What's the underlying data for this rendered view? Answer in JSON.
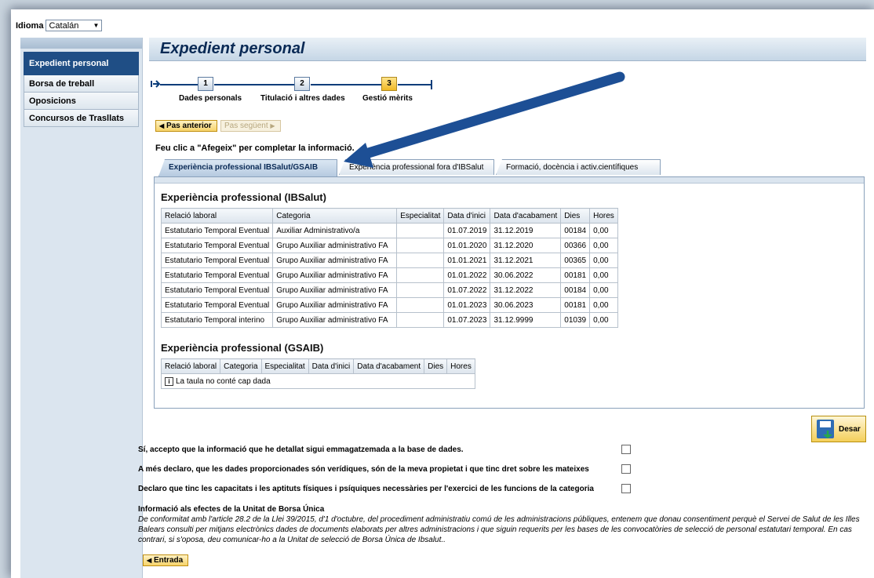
{
  "language": {
    "label": "Idioma",
    "value": "Catalán"
  },
  "sidebar": {
    "items": [
      {
        "label": "Expedient personal",
        "active": true
      },
      {
        "label": "Borsa de treball"
      },
      {
        "label": "Oposicions"
      },
      {
        "label": "Concursos de Trasllats"
      }
    ]
  },
  "header": {
    "title": "Expedient personal"
  },
  "stepper": {
    "steps": [
      {
        "number": "1",
        "label": "Dades personals"
      },
      {
        "number": "2",
        "label": "Titulació i altres dades"
      },
      {
        "number": "3",
        "label": "Gestió mèrits",
        "current": true
      }
    ]
  },
  "nav": {
    "prev_label": "Pas anterior",
    "next_label": "Pas següent"
  },
  "instruction": "Feu clic a \"Afegeix\" per completar la informació.",
  "tabs": [
    {
      "label": "Experiència professional IBSalut/GSAIB",
      "active": true
    },
    {
      "label": "Experiència professional fora d'IBSalut"
    },
    {
      "label": "Formació, docència i activ.científiques"
    }
  ],
  "ibsalut": {
    "title": "Experiència professional (IBSalut)",
    "columns": [
      "Relació laboral",
      "Categoria",
      "Especialitat",
      "Data d'inici",
      "Data d'acabament",
      "Dies",
      "Hores"
    ],
    "rows": [
      [
        "Estatutario Temporal Eventual",
        "Auxiliar Administrativo/a",
        "",
        "01.07.2019",
        "31.12.2019",
        "00184",
        "0,00"
      ],
      [
        "Estatutario Temporal Eventual",
        "Grupo Auxiliar administrativo FA",
        "",
        "01.01.2020",
        "31.12.2020",
        "00366",
        "0,00"
      ],
      [
        "Estatutario Temporal Eventual",
        "Grupo Auxiliar administrativo FA",
        "",
        "01.01.2021",
        "31.12.2021",
        "00365",
        "0,00"
      ],
      [
        "Estatutario Temporal Eventual",
        "Grupo Auxiliar administrativo FA",
        "",
        "01.01.2022",
        "30.06.2022",
        "00181",
        "0,00"
      ],
      [
        "Estatutario Temporal Eventual",
        "Grupo Auxiliar administrativo FA",
        "",
        "01.07.2022",
        "31.12.2022",
        "00184",
        "0,00"
      ],
      [
        "Estatutario Temporal Eventual",
        "Grupo Auxiliar administrativo FA",
        "",
        "01.01.2023",
        "30.06.2023",
        "00181",
        "0,00"
      ],
      [
        "Estatutario Temporal interino",
        "Grupo Auxiliar administrativo FA",
        "",
        "01.07.2023",
        "31.12.9999",
        "01039",
        "0,00"
      ]
    ]
  },
  "gsaib": {
    "title": "Experiència professional (GSAIB)",
    "columns": [
      "Relació laboral",
      "Categoria",
      "Especialitat",
      "Data d'inici",
      "Data d'acabament",
      "Dies",
      "Hores"
    ],
    "empty_message": "La taula no conté cap dada"
  },
  "save_label": "Desar",
  "consents": [
    "Sí, accepto que la informació que he detallat sigui emmagatzemada a la base de dades.",
    "A més declaro, que les dades proporcionades són verídiques, són de la meva propietat i que tinc dret sobre les mateixes",
    "Declaro que tinc les capacitats i les aptituts físiques i psíquiques necessàries per l'exercici de les funcions de la categoria"
  ],
  "info": {
    "title": "Informació als efectes de la Unitat de Borsa Única",
    "text": "De conformitat amb l'article 28.2 de la Llei 39/2015, d'1 d'octubre, del procediment administratiu comú de les administracions públiques, entenem que donau consentiment perquè el Servei de Salut de les Illes Balears consulti per mitjans electrònics dades de documents elaborats per altres administracions i que siguin requerits per les bases de les convocatòries de selecció de personal estatutari temporal. En cas contrari, si s'oposa, deu comunicar-ho a la Unitat de selecció de Borsa Única de Ibsalut.."
  },
  "entry_label": "Entrada",
  "colors": {
    "primary": "#1f4e85",
    "accent": "#f6d36a",
    "arrow": "#1d4f95"
  }
}
